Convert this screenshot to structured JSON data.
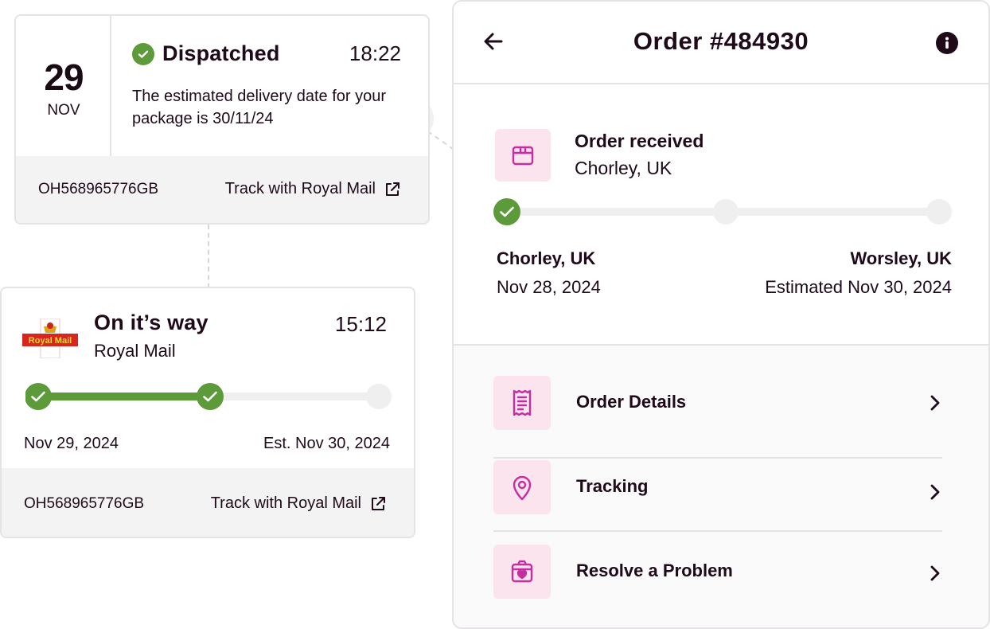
{
  "dispatched_card": {
    "day": "29",
    "month": "NOV",
    "status": "Dispatched",
    "time": "18:22",
    "description": "The estimated delivery date for your package is 30/11/24",
    "tracking_number": "OH568965776GB",
    "track_link": "Track with Royal Mail"
  },
  "onway_card": {
    "status": "On it’s way",
    "carrier": "Royal Mail",
    "logo_text": "Royal Mail",
    "time": "15:12",
    "start_date": "Nov 29, 2024",
    "end_date": "Est. Nov 30, 2024",
    "tracking_number": "OH568965776GB",
    "track_link": "Track with Royal Mail",
    "progress_completed_steps": 2,
    "progress_total_steps": 3
  },
  "order_panel": {
    "title": "Order #484930",
    "received_title": "Order received",
    "received_location": "Chorley, UK",
    "progress_completed_steps": 1,
    "progress_total_steps": 3,
    "from_location": "Chorley, UK",
    "from_date": "Nov 28, 2024",
    "to_location": "Worsley, UK",
    "to_date": "Estimated Nov 30, 2024",
    "menu": [
      {
        "label": "Order Details",
        "icon": "receipt-icon"
      },
      {
        "label": "Tracking",
        "icon": "location-pin-icon"
      },
      {
        "label": "Resolve a Problem",
        "icon": "heart-box-icon"
      }
    ]
  },
  "colors": {
    "accent_green": "#5c9a3a",
    "brand_magenta": "#c42fa0",
    "icon_bg_pink": "#fbe4ee",
    "text_dark": "#1f0a1a"
  }
}
